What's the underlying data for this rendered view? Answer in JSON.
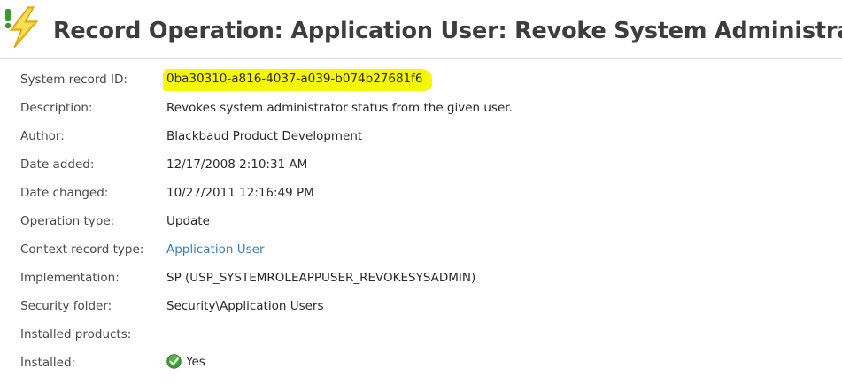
{
  "header": {
    "title": "Record Operation: Application User: Revoke System Administrato",
    "icon": "record-operation-icon"
  },
  "properties": [
    {
      "label": "System record ID:",
      "value": "0ba30310-a816-4037-a039-b074b27681f6",
      "highlight_color": "#f6f608"
    },
    {
      "label": "Description:",
      "value": "Revokes system administrator status from the given user."
    },
    {
      "label": "Author:",
      "value": "Blackbaud Product Development"
    },
    {
      "label": "Date added:",
      "value": "12/17/2008 2:10:31 AM"
    },
    {
      "label": "Date changed:",
      "value": "10/27/2011 12:16:49 PM"
    },
    {
      "label": "Operation type:",
      "value": "Update"
    },
    {
      "label": "Context record type:",
      "value": "Application User",
      "link_color": "#3e7fb2"
    },
    {
      "label": "Implementation:",
      "value": "SP (USP_SYSTEMROLEAPPUSER_REVOKESYSADMIN)"
    },
    {
      "label": "Security folder:",
      "value": "Security\\Application Users"
    },
    {
      "label": "Installed products:",
      "value": ""
    },
    {
      "label": "Installed:",
      "value": "Yes",
      "icon": "check-circle-icon"
    }
  ]
}
